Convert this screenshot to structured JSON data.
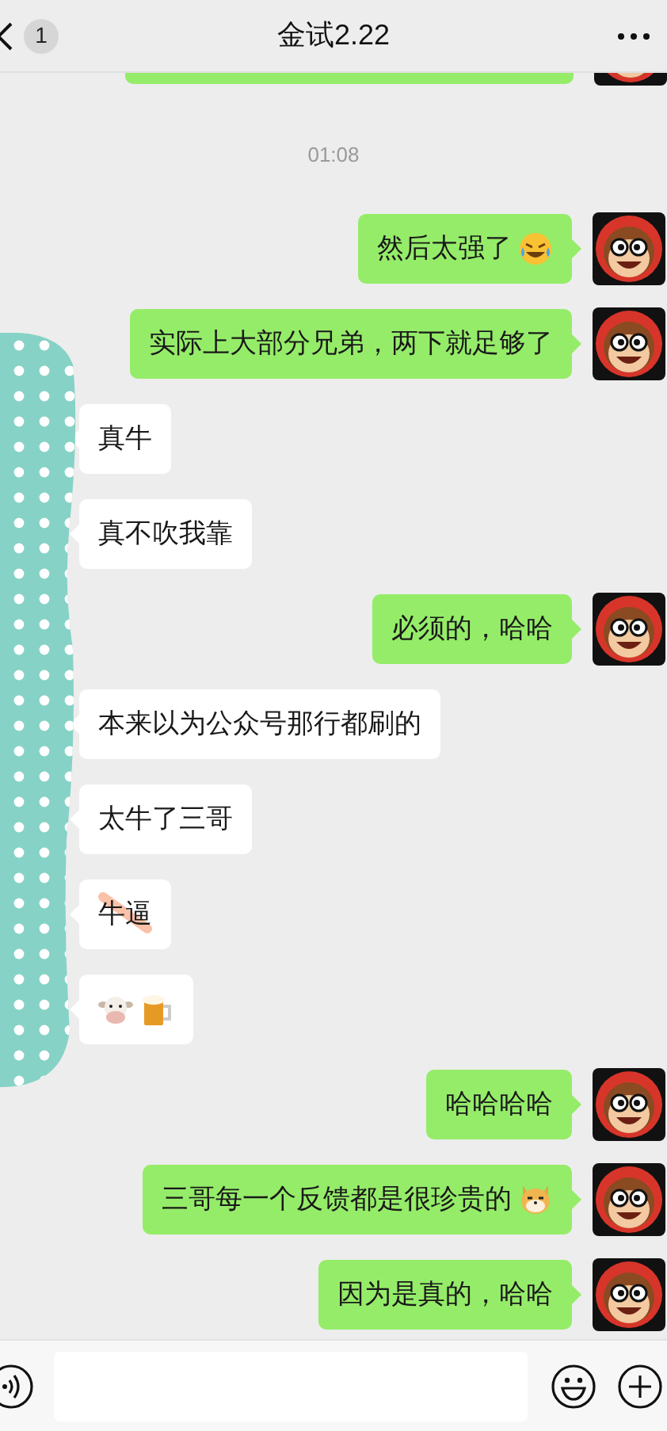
{
  "header": {
    "unread_count": "1",
    "title": "金试2.22"
  },
  "timestamp": "01:08",
  "privacy_mask": true,
  "messages": [
    {
      "kind": "sent",
      "parts": [
        {
          "kind": "text",
          "text": "然后太强了"
        },
        {
          "kind": "laughing-face"
        }
      ]
    },
    {
      "kind": "sent",
      "parts": [
        {
          "kind": "text",
          "text": "实际上大部分兄弟，两下就足够了"
        }
      ]
    },
    {
      "kind": "received",
      "parts": [
        {
          "kind": "text",
          "text": "真牛"
        }
      ]
    },
    {
      "kind": "received",
      "parts": [
        {
          "kind": "text",
          "text": "真不吹我靠"
        }
      ]
    },
    {
      "kind": "sent",
      "parts": [
        {
          "kind": "text",
          "text": "必须的，哈哈"
        }
      ]
    },
    {
      "kind": "received",
      "parts": [
        {
          "kind": "text",
          "text": "本来以为公众号那行都刷的"
        }
      ]
    },
    {
      "kind": "received",
      "parts": [
        {
          "kind": "text",
          "text": "太牛了三哥"
        }
      ]
    },
    {
      "kind": "received",
      "parts": [
        {
          "kind": "text",
          "text": "牛逼",
          "scribbled": true
        }
      ]
    },
    {
      "kind": "received",
      "parts": [
        {
          "kind": "cow-face"
        },
        {
          "kind": "beer-mug"
        }
      ]
    },
    {
      "kind": "sent",
      "parts": [
        {
          "kind": "text",
          "text": "哈哈哈哈"
        }
      ]
    },
    {
      "kind": "sent",
      "parts": [
        {
          "kind": "text",
          "text": "三哥每一个反馈都是很珍贵的"
        },
        {
          "kind": "dog-face"
        }
      ]
    },
    {
      "kind": "sent",
      "parts": [
        {
          "kind": "text",
          "text": "因为是真的，哈哈"
        }
      ]
    }
  ]
}
